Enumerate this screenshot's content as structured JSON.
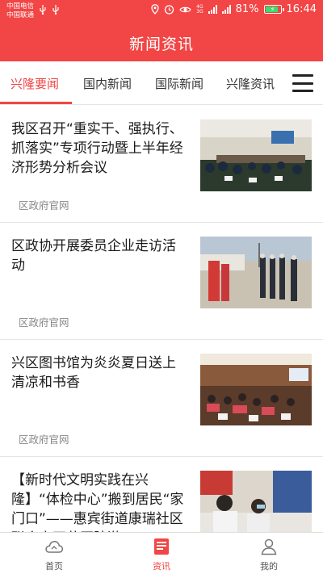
{
  "status_bar": {
    "carrier1": "中国电信",
    "carrier2": "中国联通",
    "net1": "4G",
    "net2": "3G",
    "battery": "81%",
    "time": "16:44"
  },
  "header": {
    "title": "新闻资讯"
  },
  "tabs": [
    {
      "label": "兴隆要闻",
      "active": true
    },
    {
      "label": "国内新闻",
      "active": false
    },
    {
      "label": "国际新闻",
      "active": false
    },
    {
      "label": "兴隆资讯",
      "active": false
    }
  ],
  "news": [
    {
      "title": "我区召开“重实干、强执行、抓落实”专项行动暨上半年经济形势分析会议",
      "source": "区政府官网"
    },
    {
      "title": "区政协开展委员企业走访活动",
      "source": "区政府官网"
    },
    {
      "title": "兴区图书馆为炎炎夏日送上清凉和书香",
      "source": "区政府官网"
    },
    {
      "title": "【新时代文明实践在兴隆】“体检中心”搬到居民“家门口”——惠宾街道康瑞社区联合宝石花医院激",
      "source": ""
    }
  ],
  "bottom_nav": [
    {
      "label": "首页",
      "icon": "cloud-home-icon",
      "active": false
    },
    {
      "label": "资讯",
      "icon": "news-icon",
      "active": true
    },
    {
      "label": "我的",
      "icon": "user-icon",
      "active": false
    }
  ],
  "colors": {
    "brand": "#f24545",
    "battery": "#3ddc6a"
  }
}
